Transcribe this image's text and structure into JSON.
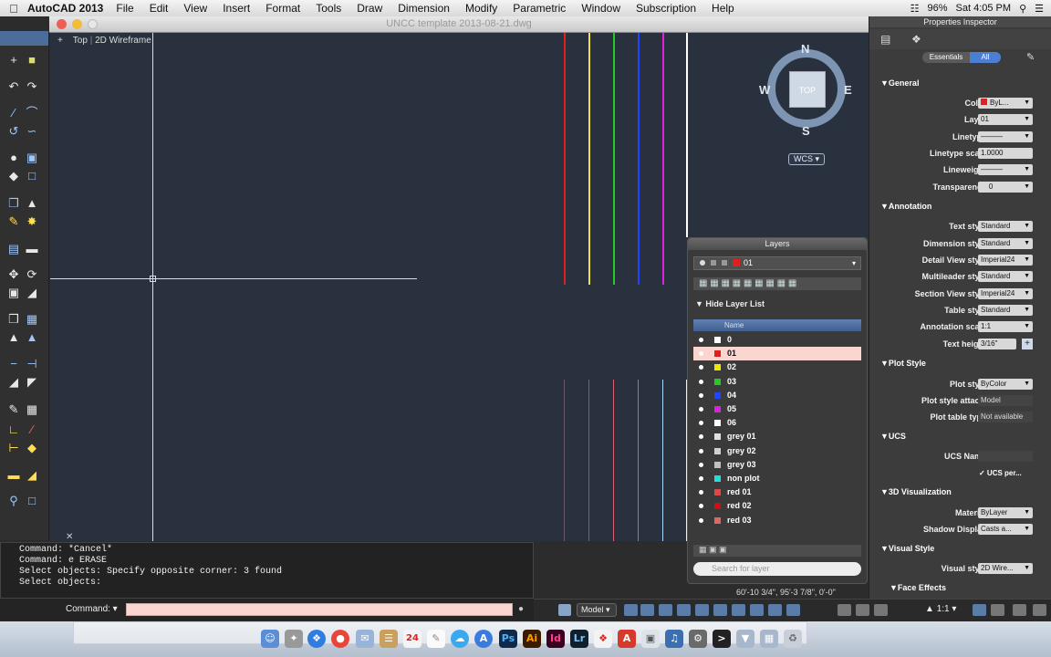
{
  "menubar": {
    "app_name": "AutoCAD 2013",
    "items": [
      "File",
      "Edit",
      "View",
      "Insert",
      "Format",
      "Tools",
      "Draw",
      "Dimension",
      "Modify",
      "Parametric",
      "Window",
      "Subscription",
      "Help"
    ],
    "battery": "96%",
    "clock": "Sat 4:05 PM"
  },
  "window": {
    "title": "UNCC template 2013-08-21.dwg"
  },
  "viewport": {
    "view": "Top",
    "visual_style": "2D Wireframe"
  },
  "viewcube": {
    "north": "N",
    "south": "S",
    "east": "E",
    "west": "W",
    "face": "TOP",
    "wcs": "WCS"
  },
  "command": {
    "history": [
      "Command: *Cancel*",
      "Command: e ERASE",
      "Select objects: Specify opposite corner: 3 found",
      "Select objects:"
    ],
    "label": "Command:",
    "input_value": ""
  },
  "status": {
    "coords": "60'-10 3/4\", 95'-3 7/8\", 0'-0\"",
    "model_tab": "Model",
    "annotation_scale": "1:1"
  },
  "layers": {
    "title": "Layers",
    "current": "01",
    "hide_label": "Hide Layer List",
    "name_column": "Name",
    "search_placeholder": "Search for layer",
    "rows": [
      {
        "name": "0",
        "color": "#ffffff",
        "selected": false
      },
      {
        "name": "01",
        "color": "#e02020",
        "selected": true
      },
      {
        "name": "02",
        "color": "#f2e600",
        "selected": false
      },
      {
        "name": "03",
        "color": "#22cc22",
        "selected": false
      },
      {
        "name": "04",
        "color": "#2244ff",
        "selected": false
      },
      {
        "name": "05",
        "color": "#dd22dd",
        "selected": false
      },
      {
        "name": "06",
        "color": "#ffffff",
        "selected": false
      },
      {
        "name": "grey 01",
        "color": "#e0e0e0",
        "selected": false
      },
      {
        "name": "grey 02",
        "color": "#d0d0d0",
        "selected": false
      },
      {
        "name": "grey 03",
        "color": "#c0c0c0",
        "selected": false
      },
      {
        "name": "non plot",
        "color": "#22dddd",
        "selected": false
      },
      {
        "name": "red 01",
        "color": "#e04848",
        "selected": false
      },
      {
        "name": "red 02",
        "color": "#d01010",
        "selected": false
      },
      {
        "name": "red 03",
        "color": "#e06666",
        "selected": false
      }
    ]
  },
  "properties": {
    "title": "Properties Inspector",
    "seg_essentials": "Essentials",
    "seg_all": "All",
    "general": {
      "header": "General",
      "color_label": "Color",
      "color_value": "ByL...",
      "layer_label": "Layer",
      "layer_value": "01",
      "linetype_label": "Linetype",
      "linetype_scale_label": "Linetype scale",
      "linetype_scale_value": "1.0000",
      "lineweight_label": "Lineweight",
      "transparency_label": "Transparency",
      "transparency_value": "0"
    },
    "annotation": {
      "header": "Annotation",
      "text_style_label": "Text style",
      "text_style_value": "Standard",
      "dim_style_label": "Dimension style",
      "dim_style_value": "Standard",
      "detail_view_label": "Detail View style",
      "detail_view_value": "Imperial24",
      "multileader_label": "Multileader style",
      "multileader_value": "Standard",
      "section_view_label": "Section View style",
      "section_view_value": "Imperial24",
      "table_style_label": "Table style",
      "table_style_value": "Standard",
      "anno_scale_label": "Annotation scale",
      "anno_scale_value": "1:1",
      "text_height_label": "Text height",
      "text_height_value": "3/16\""
    },
    "plot_style": {
      "header": "Plot Style",
      "plot_style_label": "Plot style",
      "plot_style_value": "ByColor",
      "attached_label": "Plot style attac...",
      "attached_value": "Model",
      "table_type_label": "Plot table type",
      "table_type_value": "Not available"
    },
    "ucs": {
      "header": "UCS",
      "ucs_name_label": "UCS Name",
      "ucs_name_value": "",
      "ucs_per_label": "✓ UCS per..."
    },
    "viz3d": {
      "header": "3D Visualization",
      "material_label": "Material",
      "material_value": "ByLayer",
      "shadow_label": "Shadow Display",
      "shadow_value": "Casts a..."
    },
    "visual_styles": {
      "header": "Visual Style",
      "visual_style_label": "Visual style",
      "visual_style_value": "2D Wire...",
      "face_effects": "Face Effects"
    }
  },
  "dock": {
    "calendar_day": "24",
    "apps": [
      "Ps",
      "Ai",
      "Id",
      "Lr"
    ]
  }
}
